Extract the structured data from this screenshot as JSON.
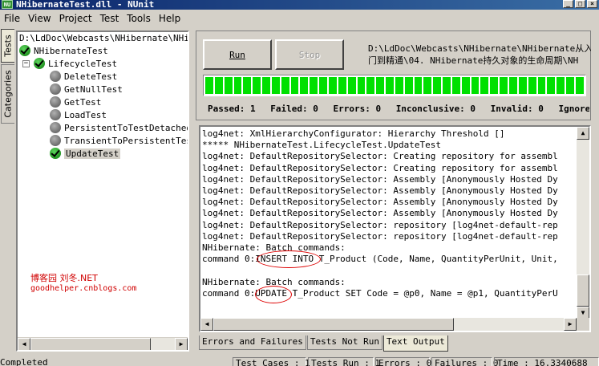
{
  "window": {
    "title": "NHibernateTest.dll - NUnit",
    "app_icon_text": "NU",
    "controls": [
      "_",
      "□",
      "×"
    ]
  },
  "menu": [
    "File",
    "View",
    "Project",
    "Test",
    "Tools",
    "Help"
  ],
  "side_tabs": {
    "tests": "Tests",
    "categories": "Categories"
  },
  "tree": {
    "path": "D:\\LdDoc\\Webcasts\\NHibernate\\NHibernateTest",
    "root": "NHibernateTest",
    "fixture": "LifecycleTest",
    "tests": [
      {
        "name": "DeleteTest",
        "status": "not-run"
      },
      {
        "name": "GetNullTest",
        "status": "not-run"
      },
      {
        "name": "GetTest",
        "status": "not-run"
      },
      {
        "name": "LoadTest",
        "status": "not-run"
      },
      {
        "name": "PersistentToTestDetached",
        "status": "not-run"
      },
      {
        "name": "TransientToPersistentTest",
        "status": "not-run"
      },
      {
        "name": "UpdateTest",
        "status": "passed"
      }
    ]
  },
  "run_panel": {
    "run_label": "Run",
    "stop_label": "Stop",
    "path_line1": "D:\\LdDoc\\Webcasts\\NHibernate\\NHibernate从入",
    "path_line2": "门到精通\\04. NHibernate持久对象的生命周期\\NH",
    "progress": 1.0,
    "progress_color": "#00e000",
    "stats": {
      "passed": "Passed: 1",
      "failed": "Failed: 0",
      "errors": "Errors: 0",
      "inconclusive": "Inconclusive: 0",
      "invalid": "Invalid: 0",
      "ignored": "Ignored:"
    }
  },
  "output_lines": [
    "log4net: XmlHierarchyConfigurator: Hierarchy Threshold []",
    "***** NHibernateTest.LifecycleTest.UpdateTest",
    "log4net: DefaultRepositorySelector: Creating repository for assembl",
    "log4net: DefaultRepositorySelector: Creating repository for assembl",
    "log4net: DefaultRepositorySelector: Assembly [Anonymously Hosted Dy",
    "log4net: DefaultRepositorySelector: Assembly [Anonymously Hosted Dy",
    "log4net: DefaultRepositorySelector: Assembly [Anonymously Hosted Dy",
    "log4net: DefaultRepositorySelector: Assembly [Anonymously Hosted Dy",
    "log4net: DefaultRepositorySelector: repository [log4net-default-rep",
    "log4net: DefaultRepositorySelector: repository [log4net-default-rep",
    "NHibernate: Batch commands:",
    "command 0:INSERT INTO T_Product (Code, Name, QuantityPerUnit, Unit,",
    "",
    "NHibernate: Batch commands:",
    "command 0:UPDATE T_Product SET Code = @p0, Name = @p1, QuantityPerU"
  ],
  "watermark": {
    "line1": "博客园  刘冬.NET",
    "line2": "goodhelper.cnblogs.com"
  },
  "bottom_tabs": [
    "Errors and Failures",
    "Tests Not Run",
    "Text Output"
  ],
  "status": {
    "main": "Completed",
    "test_cases": "Test Cases : 1",
    "tests_run": "Tests Run : 1",
    "errors": "Errors : 0",
    "failures": "Failures : 0",
    "time": "Time : 16.3340688"
  }
}
